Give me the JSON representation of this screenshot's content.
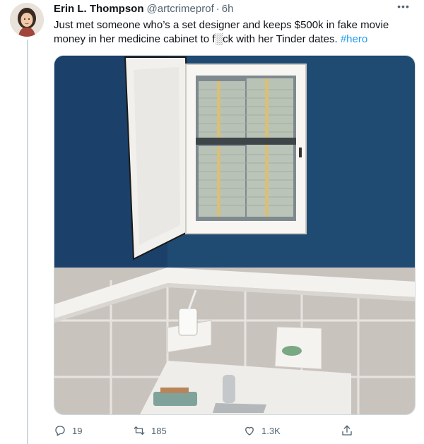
{
  "tweet": {
    "display_name": "Erin L. Thompson",
    "handle": "@artcrimeprof",
    "separator": "·",
    "time": "6h",
    "text_main": "Just met someone who’s a set designer and keeps $500k in fake movie money in her medicine cabinet to f░ck with her Tinder dates.",
    "hashtag": "#hero",
    "more_icon": "more-horizontal-icon"
  },
  "media": {
    "description_icon": "photo",
    "colors": {
      "wall_blue": "#1f4a72",
      "tile": "#c7c1bc",
      "trim": "#f2f1ee"
    }
  },
  "actions": {
    "replies": "19",
    "retweets": "185",
    "likes": "1.3K"
  },
  "colors": {
    "text": "#0f1419",
    "secondary": "#536471",
    "link": "#1d9bf0"
  }
}
